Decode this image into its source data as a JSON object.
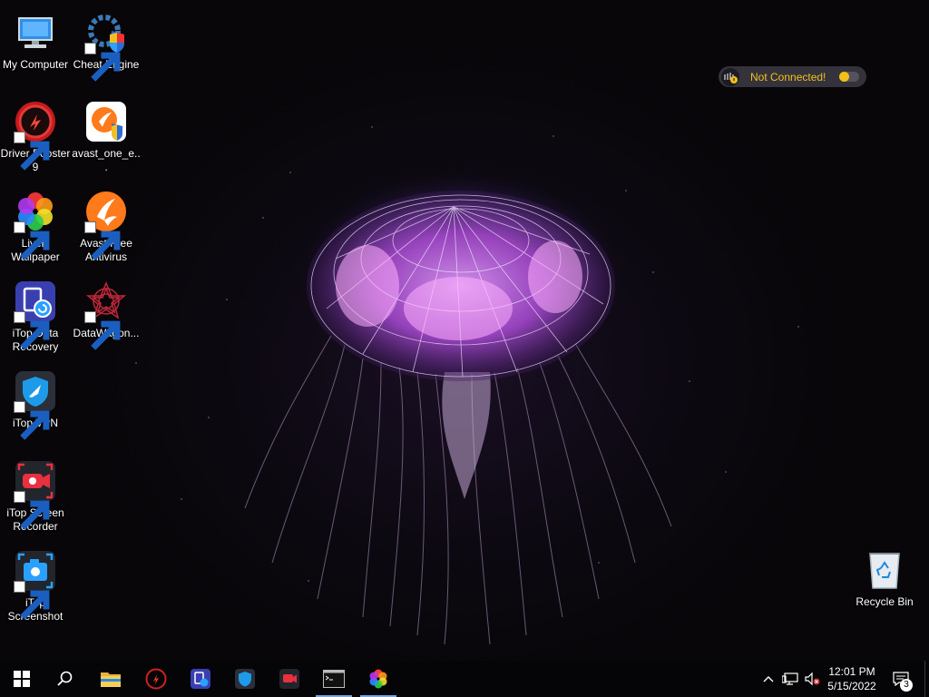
{
  "desktop": {
    "icons": [
      {
        "label": "My Computer",
        "icon": "monitor-icon"
      },
      {
        "label": "Cheat Engine",
        "icon": "cheat-engine-icon"
      },
      {
        "label": "Driver Booster 9",
        "icon": "driver-booster-icon"
      },
      {
        "label": "avast_one_e...",
        "icon": "avast-one-installer-icon"
      },
      {
        "label": "Lively Wallpaper",
        "icon": "lively-wallpaper-icon"
      },
      {
        "label": "Avast Free Antivirus",
        "icon": "avast-icon"
      },
      {
        "label": "iTop Data Recovery",
        "icon": "itop-data-recovery-icon"
      },
      {
        "label": "DataWagon...",
        "icon": "datawagon-icon"
      },
      {
        "label": "iTop VPN",
        "icon": "itop-vpn-icon"
      },
      {
        "label": "iTop Screen Recorder",
        "icon": "itop-screen-recorder-icon"
      },
      {
        "label": "iTop Screenshot",
        "icon": "itop-screenshot-icon"
      },
      {
        "label": "Recycle Bin",
        "icon": "recycle-bin-icon"
      }
    ]
  },
  "vpn_widget": {
    "status": "Not Connected!",
    "status_color": "#f0c020"
  },
  "taskbar": {
    "buttons": [
      {
        "name": "start",
        "icon": "windows-logo-icon"
      },
      {
        "name": "search",
        "icon": "search-icon"
      },
      {
        "name": "file-explorer",
        "icon": "folder-icon"
      },
      {
        "name": "driver-booster",
        "icon": "driver-booster-icon"
      },
      {
        "name": "itop-data-recovery",
        "icon": "itop-data-recovery-icon"
      },
      {
        "name": "itop-vpn",
        "icon": "itop-vpn-icon"
      },
      {
        "name": "itop-screen-recorder",
        "icon": "itop-screen-recorder-icon"
      },
      {
        "name": "command-prompt",
        "icon": "terminal-icon",
        "running": true
      },
      {
        "name": "lively-wallpaper",
        "icon": "lively-wallpaper-icon",
        "running": true
      }
    ],
    "tray": {
      "icons": [
        "chevron-up-icon",
        "network-icon",
        "volume-muted-icon"
      ],
      "time": "12:01 PM",
      "date": "5/15/2022",
      "notification_count": "3"
    }
  },
  "colors": {
    "taskbar_bg": "#050507",
    "jellyfish_glow": "#c070e0",
    "vpn_accent": "#f2c01a"
  }
}
